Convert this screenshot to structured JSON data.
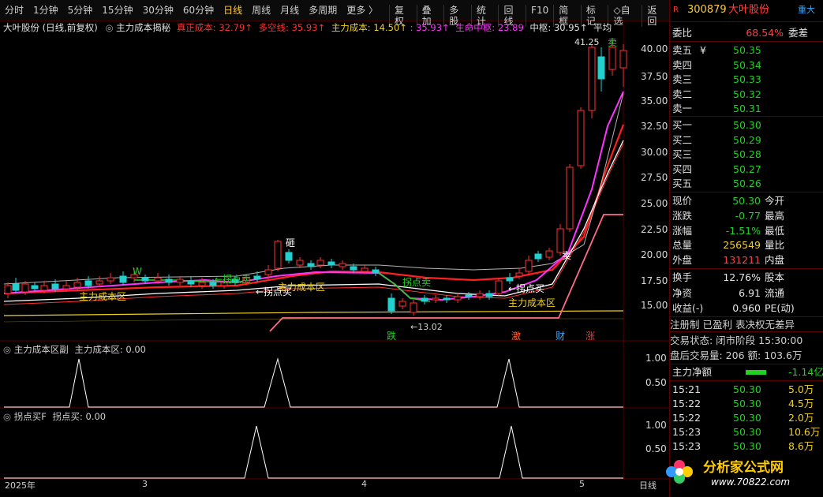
{
  "toolbar": {
    "periods": [
      "分时",
      "1分钟",
      "5分钟",
      "15分钟",
      "30分钟",
      "60分钟",
      "日线",
      "周线",
      "月线",
      "多周期",
      "更多 〉"
    ],
    "active_period": "日线",
    "actions": [
      "复权",
      "叠加",
      "多股",
      "统计",
      "回线",
      "F10",
      "简框",
      "标记",
      "◇自选",
      "返回"
    ]
  },
  "main_header": {
    "title": "大叶股份 (日线,前复权)",
    "indicator": "主力成本揭秘",
    "true_cost_label": "真正成本: 32.79↑",
    "long_short_label": "多空线: 35.93↑",
    "main_cost_label": "主力成本: 14.50↑",
    "extra_label": ": 35.93↑",
    "life_center_label": "生命中枢: 23.89",
    "center_label": "中枢: 30.95↑",
    "avg_label": "平均"
  },
  "price_axis": [
    "40.00",
    "37.50",
    "35.00",
    "32.50",
    "30.00",
    "27.50",
    "25.00",
    "22.50",
    "20.00",
    "17.50",
    "15.00"
  ],
  "annotations": {
    "high_price": "41.25",
    "low_price": "←13.02",
    "cost_zone_1": "主力成本区",
    "cost_zone_2": "主力成本区",
    "cost_zone_3": "主力成本区",
    "pick_sell_1": "←拐点卖",
    "pick_sell_2": "拐点卖",
    "pick_buy_1": "←拐点买",
    "pick_buy_2": "←拐点买",
    "sell_1": "卖",
    "sell_2": "卖",
    "w_mark": "W",
    "break_mark": "砸",
    "tag_die": "跌",
    "tag_ji": "激",
    "tag_cai": "财",
    "tag_zhang": "涨"
  },
  "sub1": {
    "title": "主力成本区副",
    "value_label": "主力成本区: 0.00",
    "ticks": [
      "1.00",
      "0.50"
    ]
  },
  "sub2": {
    "title": "拐点买F",
    "value_label": "拐点买: 0.00",
    "ticks": [
      "1.00",
      "0.50"
    ]
  },
  "x_axis": {
    "labels": [
      "2025年",
      "3",
      "4",
      "5"
    ],
    "period": "日线"
  },
  "right_panel": {
    "code": "300879",
    "name": "大叶股份",
    "tag": "重大",
    "weibi_label": "委比",
    "weibi_value": "68.54%",
    "weicha_label": "委差",
    "asks": [
      {
        "label": "卖五",
        "price": "50.35",
        "flag": "¥"
      },
      {
        "label": "卖四",
        "price": "50.34",
        "flag": ""
      },
      {
        "label": "卖三",
        "price": "50.33",
        "flag": ""
      },
      {
        "label": "卖二",
        "price": "50.32",
        "flag": ""
      },
      {
        "label": "卖一",
        "price": "50.31",
        "flag": ""
      }
    ],
    "bids": [
      {
        "label": "买一",
        "price": "50.30"
      },
      {
        "label": "买二",
        "price": "50.29"
      },
      {
        "label": "买三",
        "price": "50.28"
      },
      {
        "label": "买四",
        "price": "50.27"
      },
      {
        "label": "买五",
        "price": "50.26"
      }
    ],
    "stats": [
      {
        "l": "现价",
        "v": "50.30",
        "c": "green",
        "r": "今开"
      },
      {
        "l": "涨跌",
        "v": "-0.77",
        "c": "green",
        "r": "最高"
      },
      {
        "l": "涨幅",
        "v": "-1.51%",
        "c": "green",
        "r": "最低"
      },
      {
        "l": "总量",
        "v": "256549",
        "c": "yellow",
        "r": "量比"
      },
      {
        "l": "外盘",
        "v": "131211",
        "c": "red",
        "r": "内盘"
      }
    ],
    "stats2": [
      {
        "l": "换手",
        "v": "12.76%",
        "r": "股本"
      },
      {
        "l": "净资",
        "v": "6.91",
        "r": "流通"
      },
      {
        "l": "收益(-)",
        "v": "0.960",
        "r": "PE(动)"
      }
    ],
    "reg_line": "注册制 已盈利 表决权无差异",
    "trade_state": "交易状态: 闭市阶段 15:30:00",
    "after_hours": "盘后交易量: 206  额: 103.6万",
    "net_label": "主力净额",
    "net_value": "-1.14亿",
    "ticks": [
      {
        "t": "15:21",
        "p": "50.30",
        "v": "5.0万"
      },
      {
        "t": "15:22",
        "p": "50.30",
        "v": "4.5万"
      },
      {
        "t": "15:22",
        "p": "50.30",
        "v": "2.0万"
      },
      {
        "t": "15:23",
        "p": "50.30",
        "v": "10.6万"
      },
      {
        "t": "15:23",
        "p": "50.30",
        "v": "8.6万"
      }
    ],
    "logo_text": "分析家公式网",
    "logo_url": "www.70822.com"
  },
  "colors": {
    "up": "#ff3030",
    "down": "#22d0d0",
    "magenta": "#ff33ff",
    "cost": "#ff2222",
    "yellow": "#f0d020",
    "green": "#22d022"
  }
}
